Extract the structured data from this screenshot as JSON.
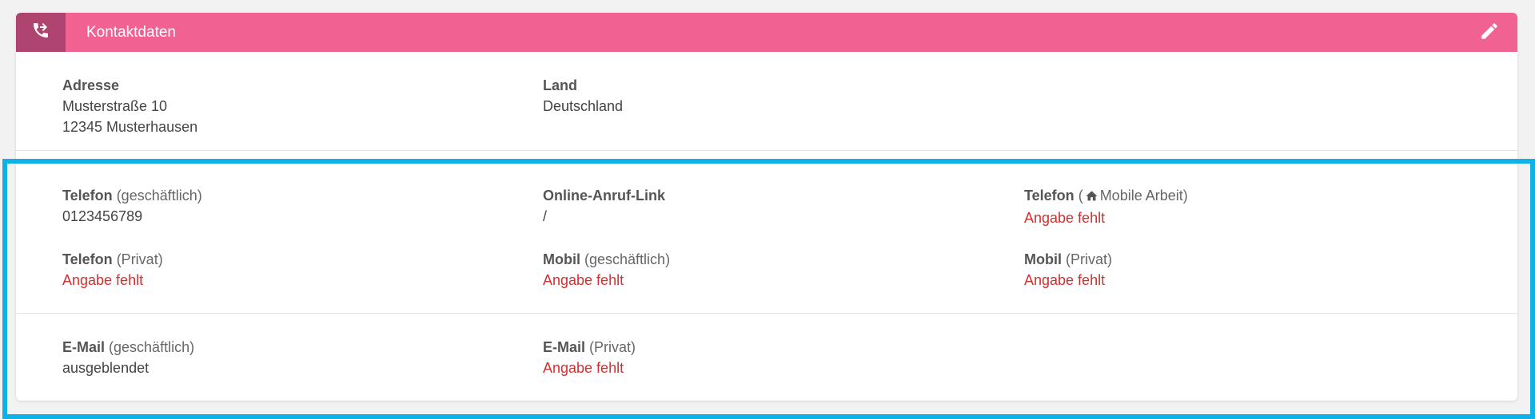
{
  "header": {
    "title": "Kontaktdaten",
    "icon": "phone-forward-icon",
    "edit_icon": "pencil-icon",
    "color": "#f06292",
    "icon_box_color": "#b04470"
  },
  "address": {
    "label": "Adresse",
    "line1": "Musterstraße 10",
    "line2": "12345 Musterhausen"
  },
  "country": {
    "label": "Land",
    "value": "Deutschland"
  },
  "phone_business": {
    "label": "Telefon",
    "qualifier": "(geschäftlich)",
    "value": "0123456789"
  },
  "online_call_link": {
    "label": "Online-Anruf-Link",
    "value": "/"
  },
  "phone_mobile_work": {
    "label": "Telefon",
    "qualifier_open": "(",
    "qualifier": "Mobile Arbeit)",
    "icon": "home-icon",
    "value": "Angabe fehlt"
  },
  "phone_private": {
    "label": "Telefon",
    "qualifier": "(Privat)",
    "value": "Angabe fehlt"
  },
  "mobile_business": {
    "label": "Mobil",
    "qualifier": "(geschäftlich)",
    "value": "Angabe fehlt"
  },
  "mobile_private": {
    "label": "Mobil",
    "qualifier": "(Privat)",
    "value": "Angabe fehlt"
  },
  "email_business": {
    "label": "E-Mail",
    "qualifier": "(geschäftlich)",
    "value": "ausgeblendet"
  },
  "email_private": {
    "label": "E-Mail",
    "qualifier": "(Privat)",
    "value": "Angabe fehlt"
  },
  "colors": {
    "missing_value": "#d32f2f",
    "highlight_frame": "#0fb1e6"
  }
}
